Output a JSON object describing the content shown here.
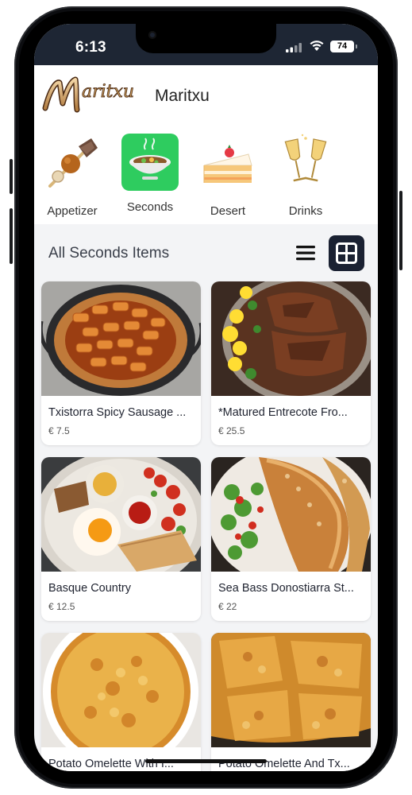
{
  "status": {
    "time": "6:13",
    "battery": "74"
  },
  "header": {
    "brand": "Maritxu",
    "logo_text": "Maritxu"
  },
  "categories": [
    {
      "label": "Appetizer",
      "icon": "skewer-icon",
      "active": false
    },
    {
      "label": "Seconds",
      "icon": "soup-bowl-icon",
      "active": true
    },
    {
      "label": "Desert",
      "icon": "cake-slice-icon",
      "active": false
    },
    {
      "label": "Drinks",
      "icon": "champagne-glasses-icon",
      "active": false
    }
  ],
  "list": {
    "title": "All Seconds Items",
    "view_mode": "grid"
  },
  "items": [
    {
      "name": "Txistorra Spicy Sausage ...",
      "price": "€ 7.5"
    },
    {
      "name": "*Matured Entrecote Fro...",
      "price": "€ 25.5"
    },
    {
      "name": "Basque Country",
      "price": "€ 12.5"
    },
    {
      "name": "Sea Bass Donostiarra St...",
      "price": "€ 22"
    },
    {
      "name": "Potato Omelette With I...",
      "price": ""
    },
    {
      "name": "Potato Omelette And Tx...",
      "price": ""
    }
  ],
  "colors": {
    "accent_green": "#2ecc5f",
    "dark_button": "#1a2132",
    "status_bar": "#1e2634"
  }
}
